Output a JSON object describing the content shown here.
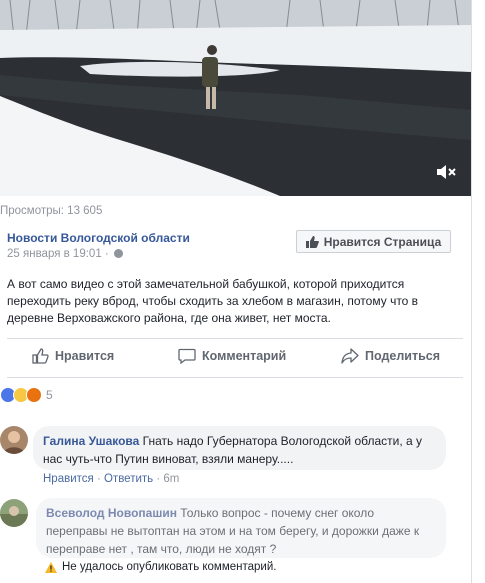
{
  "video": {
    "mute_icon": "speaker-muted-icon"
  },
  "post": {
    "views": "Просмотры: 13 605",
    "page_name": "Новости Вологодской области",
    "date": "25 января в 19:01 ·",
    "like_page_button": "Нравится Страница",
    "text": "А вот само видео с этой замечательной бабушкой, которой приходится переходить реку вброд, чтобы сходить за хлебом в магазин, потому что в деревне Верховажского района, где она живет, нет моста."
  },
  "actions": {
    "like": "Нравится",
    "comment": "Комментарий",
    "share": "Поделиться"
  },
  "reactions": {
    "count": "5",
    "types": [
      "like",
      "sad",
      "angry"
    ],
    "colors": {
      "like": "#4a76e8",
      "sad": "#f7c844",
      "angry": "#e9710f"
    }
  },
  "comments": [
    {
      "author": "Галина Ушакова",
      "text": "Гнать надо Губернатора Вологодской области, а у нас чуть-что Путин виноват, взяли манеру.....",
      "like_label": "Нравится",
      "reply_label": "Ответить",
      "time": "6m"
    },
    {
      "author": "Всеволод Новопашин",
      "text": "Только вопрос - почему снег около переправы не вытоптан на этом и на том берегу, и дорожки даже к переправе нет , там что, люди не ходят ?",
      "error": "Не удалось опубликовать комментарий."
    }
  ]
}
